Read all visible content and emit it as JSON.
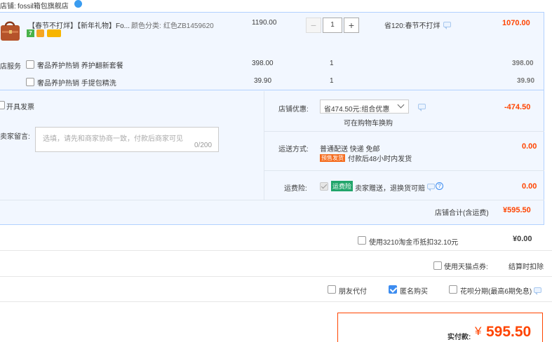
{
  "shop": {
    "label": "店铺:",
    "name": "fossil箱包旗舰店"
  },
  "product": {
    "title": "【春节不打烊】【新年礼物】Fo...",
    "sku_label": "颜色分类:",
    "sku_value": "红色ZB1459620",
    "price": "1190.00",
    "quantity": "1",
    "promo": "省120:春节不打烊",
    "subtotal": "1070.00",
    "minus_label": "−",
    "plus_label": "+"
  },
  "services": {
    "section_label": "店服务",
    "items": [
      {
        "name": "奢品养护热销 养护翻新套餐",
        "price": "398.00",
        "qty": "1",
        "subtotal": "398.00"
      },
      {
        "name": "奢品养护热销 手提包精洗",
        "price": "39.90",
        "qty": "1",
        "subtotal": "39.90"
      }
    ]
  },
  "invoice": {
    "label": "开具发票"
  },
  "message": {
    "label": "卖家留言:",
    "placeholder": "选填，请先和商家协商一致，付款后商家可见",
    "counter": "0/200"
  },
  "shop_discount": {
    "label": "店铺优惠:",
    "selected": "省474.50元:组合优惠",
    "note": "可在购物车换购",
    "amount": "-474.50"
  },
  "shipping": {
    "label": "运送方式:",
    "method": "普通配送 快递 免邮",
    "badge": "预售发货",
    "note": "付款后48小时内发货",
    "amount": "0.00"
  },
  "insurance": {
    "label": "运费险:",
    "badge": "运费险",
    "text": "卖家赠送，退换货可赔",
    "amount": "0.00"
  },
  "shop_total": {
    "label": "店铺合计(含运费)",
    "amount": "¥595.50"
  },
  "tao_coin": {
    "label": "使用3210淘金币抵扣32.10元",
    "amount": "¥0.00"
  },
  "tmall_points": {
    "label": "使用天猫点券:",
    "note": "结算时扣除"
  },
  "options": {
    "friend_pay": "朋友代付",
    "anonymous": "匿名购买",
    "huabei": "花呗分期(最高6期免息)"
  },
  "payment": {
    "label": "实付款:",
    "currency": "¥",
    "amount": "595.50"
  },
  "colors": {
    "accent_red": "#ff4400",
    "light_blue": "#f2f7ff",
    "border_blue": "#b2d1ff",
    "checkbox_blue": "#3c8cf0"
  }
}
